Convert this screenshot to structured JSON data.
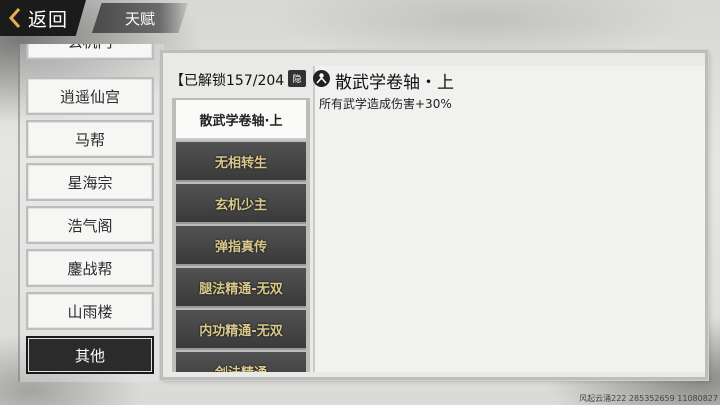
{
  "header": {
    "back_label": "返回",
    "title": "天赋"
  },
  "categories": [
    {
      "label": "玄机门",
      "active": false
    },
    {
      "label": "逍遥仙宫",
      "active": false
    },
    {
      "label": "马帮",
      "active": false
    },
    {
      "label": "星海宗",
      "active": false
    },
    {
      "label": "浩气阁",
      "active": false
    },
    {
      "label": "鏖战帮",
      "active": false
    },
    {
      "label": "山雨楼",
      "active": false
    },
    {
      "label": "其他",
      "active": true
    }
  ],
  "panel": {
    "unlock_text": "【已解锁157/204",
    "hide_badge": "隐"
  },
  "talents": [
    {
      "label": "散武学卷轴·上",
      "active": true
    },
    {
      "label": "无相转生",
      "active": false
    },
    {
      "label": "玄机少主",
      "active": false
    },
    {
      "label": "弹指真传",
      "active": false
    },
    {
      "label": "腿法精通-无双",
      "active": false
    },
    {
      "label": "内功精通-无双",
      "active": false
    },
    {
      "label": "剑法精通",
      "active": false
    }
  ],
  "detail": {
    "icon": "person-circle-icon",
    "title": "散武学卷轴・上",
    "description": "所有武学造成伤害+30%"
  },
  "watermark": "风起云涌222  285352659  11080827",
  "colors": {
    "active_category_bg": "#2b2b2b",
    "talent_text": "#d9c98c",
    "talent_bg": "#424242"
  }
}
